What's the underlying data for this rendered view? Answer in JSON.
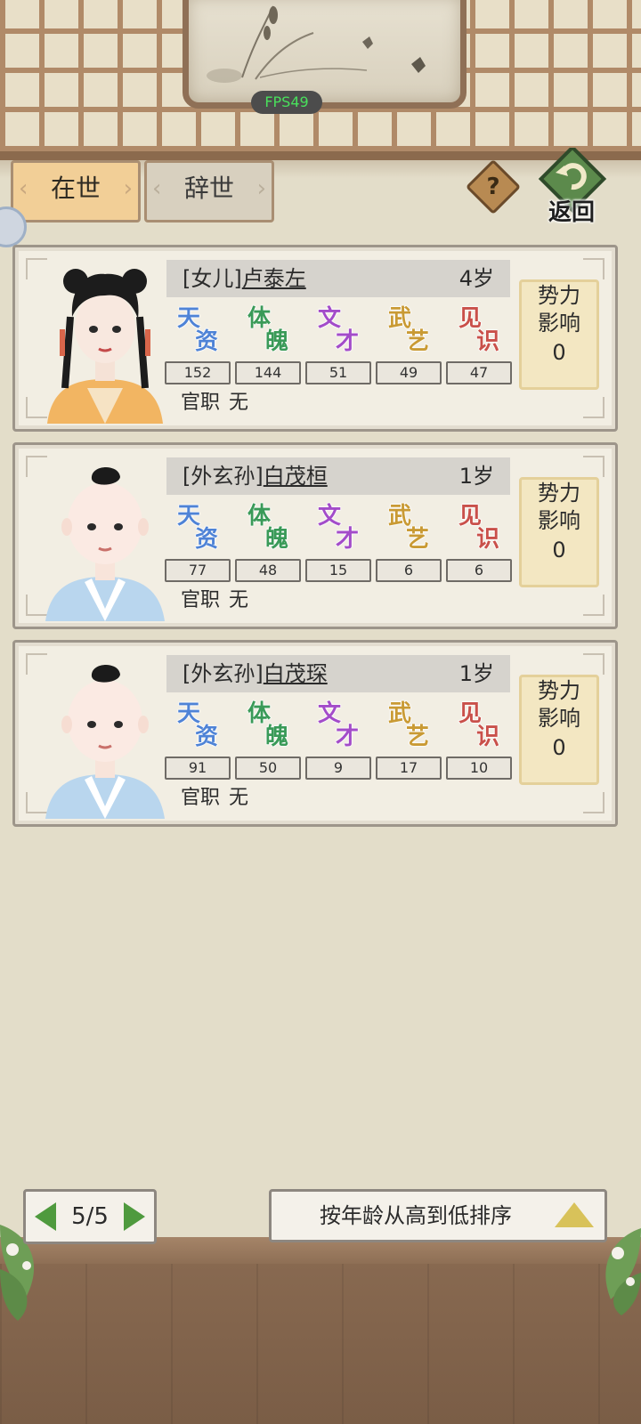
{
  "header": {
    "fps": "FPS49"
  },
  "tabs": [
    {
      "label": "在世",
      "active": true
    },
    {
      "label": "辞世",
      "active": false
    }
  ],
  "help_label": "?",
  "back_label": "返回",
  "stat_labels": [
    {
      "chars": [
        "天",
        "资"
      ],
      "color": "#4f83d6"
    },
    {
      "chars": [
        "体",
        "魄"
      ],
      "color": "#3a9a58"
    },
    {
      "chars": [
        "文",
        "才"
      ],
      "color": "#a34cc9"
    },
    {
      "chars": [
        "武",
        "艺"
      ],
      "color": "#c99a34"
    },
    {
      "chars": [
        "见",
        "识"
      ],
      "color": "#c9504a"
    }
  ],
  "office_label": "官职",
  "influence_label": [
    "势力",
    "影响"
  ],
  "members": [
    {
      "relation": "[女儿]",
      "name": "卢泰左",
      "age": "4岁",
      "stats": [
        "152",
        "144",
        "51",
        "49",
        "47"
      ],
      "office": "无",
      "influence": "0"
    },
    {
      "relation": "[外玄孙]",
      "name": "白茂桓",
      "age": "1岁",
      "stats": [
        "77",
        "48",
        "15",
        "6",
        "6"
      ],
      "office": "无",
      "influence": "0"
    },
    {
      "relation": "[外玄孙]",
      "name": "白茂琛",
      "age": "1岁",
      "stats": [
        "91",
        "50",
        "9",
        "17",
        "10"
      ],
      "office": "无",
      "influence": "0"
    }
  ],
  "pager": {
    "text": "5/5"
  },
  "sort": {
    "label": "按年龄从高到低排序"
  }
}
